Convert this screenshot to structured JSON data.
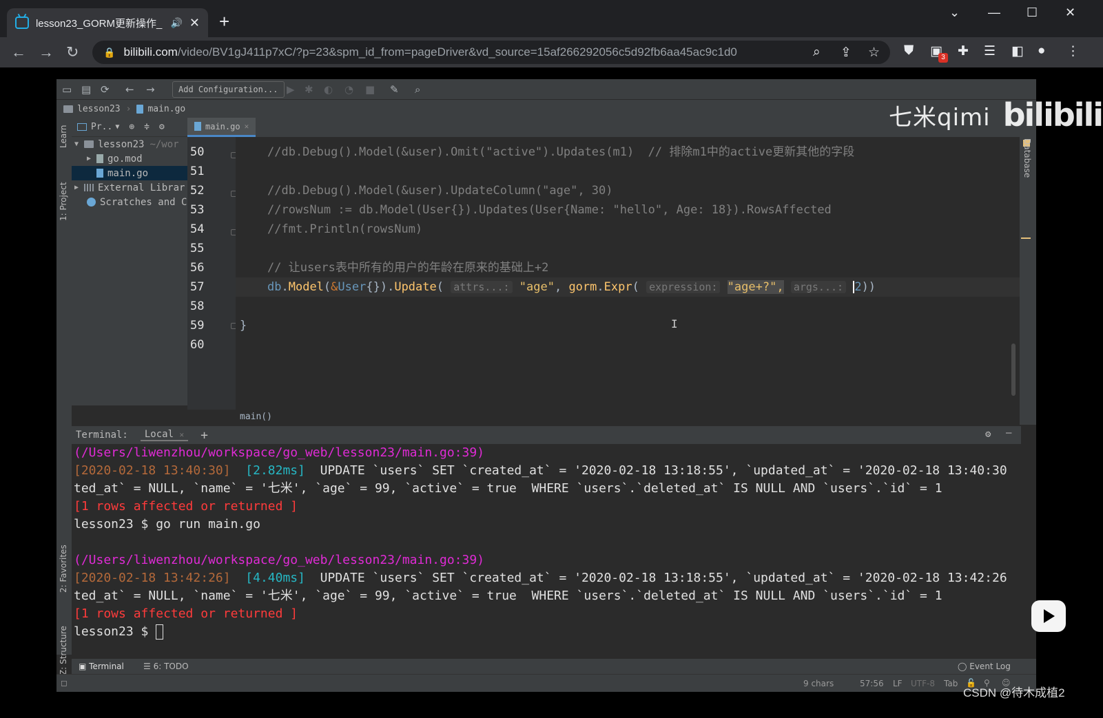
{
  "browser": {
    "tab_title": "lesson23_GORM更新操作_",
    "audio_icon": "speaker-icon",
    "url_host": "bilibili.com",
    "url_path": "/video/BV1gJ411p7xC/?p=23&spm_id_from=pageDriver&vd_source=15af266292056c5d92fb6aa45ac9c1d0",
    "extension_badge": "3"
  },
  "ide": {
    "toolbar": {
      "add_configuration": "Add Configuration..."
    },
    "breadcrumb": {
      "project": "lesson23",
      "file": "main.go"
    },
    "left_stripe": {
      "learn": "Learn",
      "project": "1: Project",
      "favorites": "2: Favorites",
      "structure": "Z: Structure"
    },
    "right_stripe": {
      "database": "Database"
    },
    "project_panel": {
      "header": "Pr..",
      "items": [
        {
          "label": "lesson23",
          "suffix": "~/wor"
        },
        {
          "label": "go.mod"
        },
        {
          "label": "main.go"
        },
        {
          "label": "External Librar"
        },
        {
          "label": "Scratches and C"
        }
      ]
    },
    "editor_tab": "main.go",
    "line_numbers": [
      "50",
      "51",
      "52",
      "53",
      "54",
      "55",
      "56",
      "57",
      "58",
      "59",
      "60"
    ],
    "code": {
      "l50": "//db.Debug().Model(&user).Omit(\"active\").Updates(m1)  // 排除m1中的active更新其他的字段",
      "l52": "//db.Debug().Model(&user).UpdateColumn(\"age\", 30)",
      "l53": "//rowsNum := db.Model(User{}).Updates(User{Name: \"hello\", Age: 18}).RowsAffected",
      "l54": "//fmt.Println(rowsNum)",
      "l56": "// 让users表中所有的用户的年龄在原来的基础上+2",
      "l57_db": "db",
      "l57_model": "Model",
      "l57_user": "User",
      "l57_update": "Update",
      "l57_hint_attrs": "attrs...:",
      "l57_str_age": "\"age\"",
      "l57_gorm": "gorm",
      "l57_expr": "Expr",
      "l57_hint_expr": "expression:",
      "l57_str_expr": "\"age+?\",",
      "l57_hint_args": "args...:",
      "l57_arg": "2",
      "l59": "}"
    },
    "editor_breadcrumb": "main()",
    "terminal": {
      "label": "Terminal:",
      "tab": "Local",
      "lines": {
        "t1": "(/Users/liwenzhou/workspace/go_web/lesson23/main.go:39)",
        "t2_ts": "[2020-02-18 13:40:30]",
        "t2_ms": "[2.82ms]",
        "t2_sql": "UPDATE `users` SET `created_at` = '2020-02-18 13:18:55', `updated_at` = '2020-02-18 13:40:30', `dele",
        "t3": "ted_at` = NULL, `name` = '七米', `age` = 99, `active` = true  WHERE `users`.`deleted_at` IS NULL AND `users`.`id` = 1",
        "t4": "[1 rows affected or returned ]",
        "t5": "lesson23 $ go run main.go",
        "t7": "(/Users/liwenzhou/workspace/go_web/lesson23/main.go:39)",
        "t8_ts": "[2020-02-18 13:42:26]",
        "t8_ms": "[4.40ms]",
        "t8_sql": "UPDATE `users` SET `created_at` = '2020-02-18 13:18:55', `updated_at` = '2020-02-18 13:42:26', `dele",
        "t9": "ted_at` = NULL, `name` = '七米', `age` = 99, `active` = true  WHERE `users`.`deleted_at` IS NULL AND `users`.`id` = 1",
        "t10": "[1 rows affected or returned ]",
        "t11": "lesson23 $"
      }
    },
    "bottom_tabs": {
      "terminal": "Terminal",
      "todo": "6: TODO",
      "event_log": "Event Log"
    },
    "status": {
      "chars": "9 chars",
      "position": "57:56",
      "line_sep": "LF",
      "encoding": "UTF-8",
      "indent": "Tab"
    }
  },
  "overlays": {
    "watermark_text": "七米qimi",
    "watermark_logo": "bilibili",
    "csdn": "CSDN @待木成植2"
  },
  "colors": {
    "browser_bg": "#202124",
    "ide_bg": "#2b2b2b",
    "comment": "#808080",
    "string": "#e8bf6a",
    "terminal_path": "#e02bd6",
    "terminal_red": "#ff3b3b"
  }
}
